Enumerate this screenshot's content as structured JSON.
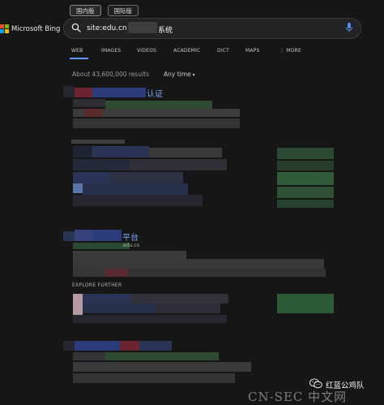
{
  "region_tabs": [
    {
      "label": "国内版"
    },
    {
      "label": "国际版"
    }
  ],
  "logo": {
    "text": "Microsoft Bing"
  },
  "search": {
    "query_visible": "site:edu.cn",
    "query_suffix": "系统"
  },
  "nav": [
    {
      "label": "WEB"
    },
    {
      "label": "IMAGES"
    },
    {
      "label": "VIDEOS"
    },
    {
      "label": "ACADEMIC"
    },
    {
      "label": "DICT"
    },
    {
      "label": "MAPS"
    },
    {
      "label": "⋮ MORE"
    }
  ],
  "results": {
    "count": "About 43,600,000 results",
    "filter": "Any time"
  },
  "result1": {
    "title_suffix": "认证"
  },
  "result2": {
    "title_suffix": "平台",
    "url_fragment": "edu.cn"
  },
  "explore_further": "EXPLORE FURTHER",
  "watermark": {
    "brand": "红蓝公鸡队",
    "site": "CN-SEC 中文网"
  },
  "colors": {
    "accent": "#5b9bf8",
    "link": "#7aa9f7",
    "background": "#161616"
  }
}
